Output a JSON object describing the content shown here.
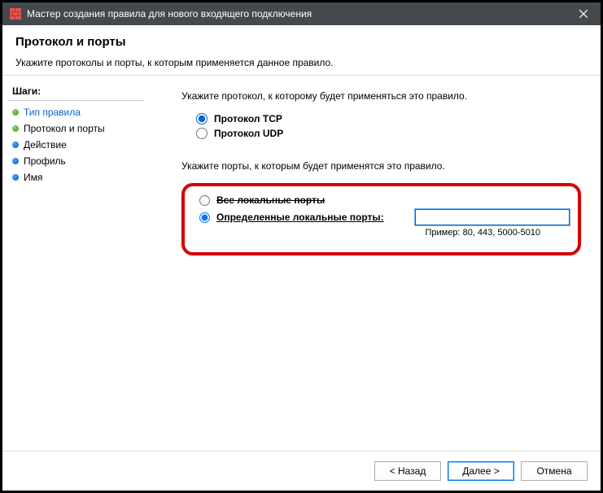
{
  "titlebar": {
    "title": "Мастер создания правила для нового входящего подключения"
  },
  "header": {
    "title": "Протокол и порты",
    "subtitle": "Укажите протоколы и порты, к которым применяется данное правило."
  },
  "sidebar": {
    "heading": "Шаги:",
    "steps": [
      {
        "label": "Тип правила"
      },
      {
        "label": "Протокол и порты"
      },
      {
        "label": "Действие"
      },
      {
        "label": "Профиль"
      },
      {
        "label": "Имя"
      }
    ]
  },
  "main": {
    "protocol_prompt": "Укажите протокол, к которому будет применяться это правило.",
    "protocol_tcp": "Протокол TCP",
    "protocol_udp": "Протокол UDP",
    "ports_prompt": "Укажите порты, к которым будет применятся это правило.",
    "all_ports": "Все локальные порты",
    "specific_ports": "Определенные локальные порты:",
    "port_value": "",
    "example": "Пример: 80, 443, 5000-5010"
  },
  "footer": {
    "back": "< Назад",
    "next": "Далее >",
    "cancel": "Отмена"
  }
}
